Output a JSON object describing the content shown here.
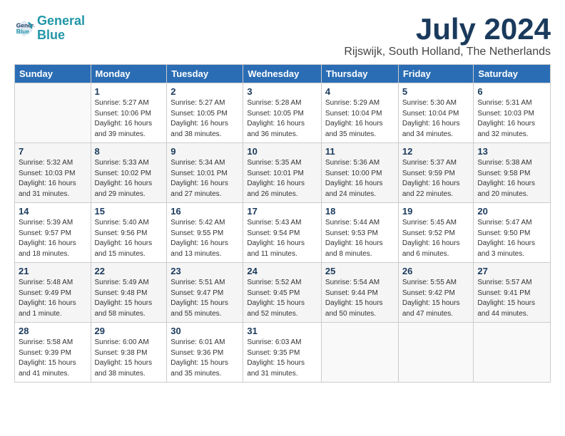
{
  "header": {
    "logo_line1": "General",
    "logo_line2": "Blue",
    "title": "July 2024",
    "location": "Rijswijk, South Holland, The Netherlands"
  },
  "weekdays": [
    "Sunday",
    "Monday",
    "Tuesday",
    "Wednesday",
    "Thursday",
    "Friday",
    "Saturday"
  ],
  "weeks": [
    [
      {
        "day": "",
        "info": ""
      },
      {
        "day": "1",
        "info": "Sunrise: 5:27 AM\nSunset: 10:06 PM\nDaylight: 16 hours\nand 39 minutes."
      },
      {
        "day": "2",
        "info": "Sunrise: 5:27 AM\nSunset: 10:05 PM\nDaylight: 16 hours\nand 38 minutes."
      },
      {
        "day": "3",
        "info": "Sunrise: 5:28 AM\nSunset: 10:05 PM\nDaylight: 16 hours\nand 36 minutes."
      },
      {
        "day": "4",
        "info": "Sunrise: 5:29 AM\nSunset: 10:04 PM\nDaylight: 16 hours\nand 35 minutes."
      },
      {
        "day": "5",
        "info": "Sunrise: 5:30 AM\nSunset: 10:04 PM\nDaylight: 16 hours\nand 34 minutes."
      },
      {
        "day": "6",
        "info": "Sunrise: 5:31 AM\nSunset: 10:03 PM\nDaylight: 16 hours\nand 32 minutes."
      }
    ],
    [
      {
        "day": "7",
        "info": "Sunrise: 5:32 AM\nSunset: 10:03 PM\nDaylight: 16 hours\nand 31 minutes."
      },
      {
        "day": "8",
        "info": "Sunrise: 5:33 AM\nSunset: 10:02 PM\nDaylight: 16 hours\nand 29 minutes."
      },
      {
        "day": "9",
        "info": "Sunrise: 5:34 AM\nSunset: 10:01 PM\nDaylight: 16 hours\nand 27 minutes."
      },
      {
        "day": "10",
        "info": "Sunrise: 5:35 AM\nSunset: 10:01 PM\nDaylight: 16 hours\nand 26 minutes."
      },
      {
        "day": "11",
        "info": "Sunrise: 5:36 AM\nSunset: 10:00 PM\nDaylight: 16 hours\nand 24 minutes."
      },
      {
        "day": "12",
        "info": "Sunrise: 5:37 AM\nSunset: 9:59 PM\nDaylight: 16 hours\nand 22 minutes."
      },
      {
        "day": "13",
        "info": "Sunrise: 5:38 AM\nSunset: 9:58 PM\nDaylight: 16 hours\nand 20 minutes."
      }
    ],
    [
      {
        "day": "14",
        "info": "Sunrise: 5:39 AM\nSunset: 9:57 PM\nDaylight: 16 hours\nand 18 minutes."
      },
      {
        "day": "15",
        "info": "Sunrise: 5:40 AM\nSunset: 9:56 PM\nDaylight: 16 hours\nand 15 minutes."
      },
      {
        "day": "16",
        "info": "Sunrise: 5:42 AM\nSunset: 9:55 PM\nDaylight: 16 hours\nand 13 minutes."
      },
      {
        "day": "17",
        "info": "Sunrise: 5:43 AM\nSunset: 9:54 PM\nDaylight: 16 hours\nand 11 minutes."
      },
      {
        "day": "18",
        "info": "Sunrise: 5:44 AM\nSunset: 9:53 PM\nDaylight: 16 hours\nand 8 minutes."
      },
      {
        "day": "19",
        "info": "Sunrise: 5:45 AM\nSunset: 9:52 PM\nDaylight: 16 hours\nand 6 minutes."
      },
      {
        "day": "20",
        "info": "Sunrise: 5:47 AM\nSunset: 9:50 PM\nDaylight: 16 hours\nand 3 minutes."
      }
    ],
    [
      {
        "day": "21",
        "info": "Sunrise: 5:48 AM\nSunset: 9:49 PM\nDaylight: 16 hours\nand 1 minute."
      },
      {
        "day": "22",
        "info": "Sunrise: 5:49 AM\nSunset: 9:48 PM\nDaylight: 15 hours\nand 58 minutes."
      },
      {
        "day": "23",
        "info": "Sunrise: 5:51 AM\nSunset: 9:47 PM\nDaylight: 15 hours\nand 55 minutes."
      },
      {
        "day": "24",
        "info": "Sunrise: 5:52 AM\nSunset: 9:45 PM\nDaylight: 15 hours\nand 52 minutes."
      },
      {
        "day": "25",
        "info": "Sunrise: 5:54 AM\nSunset: 9:44 PM\nDaylight: 15 hours\nand 50 minutes."
      },
      {
        "day": "26",
        "info": "Sunrise: 5:55 AM\nSunset: 9:42 PM\nDaylight: 15 hours\nand 47 minutes."
      },
      {
        "day": "27",
        "info": "Sunrise: 5:57 AM\nSunset: 9:41 PM\nDaylight: 15 hours\nand 44 minutes."
      }
    ],
    [
      {
        "day": "28",
        "info": "Sunrise: 5:58 AM\nSunset: 9:39 PM\nDaylight: 15 hours\nand 41 minutes."
      },
      {
        "day": "29",
        "info": "Sunrise: 6:00 AM\nSunset: 9:38 PM\nDaylight: 15 hours\nand 38 minutes."
      },
      {
        "day": "30",
        "info": "Sunrise: 6:01 AM\nSunset: 9:36 PM\nDaylight: 15 hours\nand 35 minutes."
      },
      {
        "day": "31",
        "info": "Sunrise: 6:03 AM\nSunset: 9:35 PM\nDaylight: 15 hours\nand 31 minutes."
      },
      {
        "day": "",
        "info": ""
      },
      {
        "day": "",
        "info": ""
      },
      {
        "day": "",
        "info": ""
      }
    ]
  ]
}
